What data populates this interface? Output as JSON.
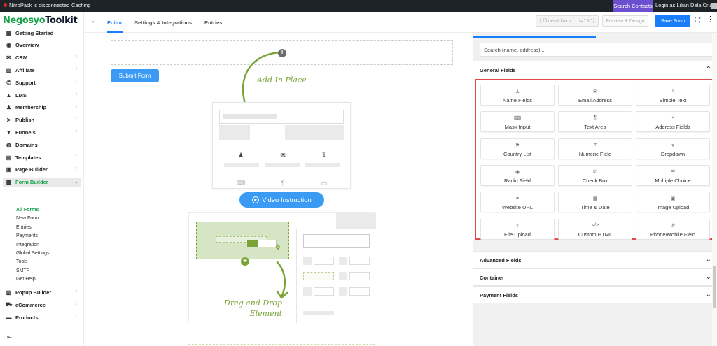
{
  "topbar": {
    "nitro": "NitroPack is disconnected",
    "caching": "Caching",
    "search_contacts": "Search Contacts",
    "login": "Login as Lilian Dela Cruz"
  },
  "logo": {
    "part1": "Negosyo",
    "part2": "Toolkit"
  },
  "sidebar": {
    "items": [
      {
        "label": "Getting Started",
        "icon": "grid-icon",
        "chevron": false
      },
      {
        "label": "Overview",
        "icon": "eye-icon",
        "chevron": false
      },
      {
        "label": "CRM",
        "icon": "mail-icon",
        "chevron": true
      },
      {
        "label": "Affiliate",
        "icon": "chart-icon",
        "chevron": true
      },
      {
        "label": "Support",
        "icon": "whatsapp-icon",
        "chevron": true
      },
      {
        "label": "LMS",
        "icon": "graduation-icon",
        "chevron": true
      },
      {
        "label": "Membership",
        "icon": "users-icon",
        "chevron": true
      },
      {
        "label": "Publish",
        "icon": "send-icon",
        "chevron": true
      },
      {
        "label": "Funnels",
        "icon": "funnel-icon",
        "chevron": true
      },
      {
        "label": "Domains",
        "icon": "globe-icon",
        "chevron": false
      },
      {
        "label": "Templates",
        "icon": "template-icon",
        "chevron": true
      },
      {
        "label": "Page Builder",
        "icon": "page-icon",
        "chevron": true
      },
      {
        "label": "Form Builder",
        "icon": "form-icon",
        "chevron": true
      }
    ],
    "sub_items": [
      "All Forms",
      "New Form",
      "Entries",
      "Payments",
      "Integration",
      "Global Settings",
      "Tools",
      "SMTP",
      "Get Help"
    ],
    "bottom_items": [
      {
        "label": "Popup Builder",
        "icon": "popup-icon",
        "chevron": true
      },
      {
        "label": "eCommerce",
        "icon": "cart-icon",
        "chevron": true
      },
      {
        "label": "Products",
        "icon": "box-icon",
        "chevron": true
      }
    ],
    "collapse_glyph": "⇤"
  },
  "nav": {
    "tabs": [
      "Editor",
      "Settings & Integrations",
      "Entries"
    ]
  },
  "header": {
    "shortcode": "[fluentform id=\"5\"]",
    "preview": "Preview & Design",
    "save": "Save Form"
  },
  "editor": {
    "submit": "Submit Form",
    "add_in_place": "Add In Place",
    "video": "Video Instruction",
    "drag_line1": "Drag and Drop",
    "drag_line2": "Element"
  },
  "panel": {
    "search_placeholder": "Search (name, address)...",
    "general_title": "General Fields",
    "fields": [
      {
        "label": "Name Fields",
        "icon": "user-icon",
        "glyph": "♙"
      },
      {
        "label": "Email Address",
        "icon": "envelope-icon",
        "glyph": "✉"
      },
      {
        "label": "Simple Text",
        "icon": "text-icon",
        "glyph": "T"
      },
      {
        "label": "Mask Input",
        "icon": "keyboard-icon",
        "glyph": "⌨"
      },
      {
        "label": "Text Area",
        "icon": "paragraph-icon",
        "glyph": "¶"
      },
      {
        "label": "Address Fields",
        "icon": "location-icon",
        "glyph": "⌖"
      },
      {
        "label": "Country List",
        "icon": "flag-icon",
        "glyph": "⚑"
      },
      {
        "label": "Numeric Field",
        "icon": "hash-icon",
        "glyph": "#"
      },
      {
        "label": "Dropdown",
        "icon": "dropdown-icon",
        "glyph": "▾"
      },
      {
        "label": "Radio Field",
        "icon": "radio-icon",
        "glyph": "◉"
      },
      {
        "label": "Check Box",
        "icon": "checkbox-icon",
        "glyph": "☑"
      },
      {
        "label": "Multiple Choice",
        "icon": "list-icon",
        "glyph": "☰"
      },
      {
        "label": "Website URL",
        "icon": "link-icon",
        "glyph": "⚭"
      },
      {
        "label": "Time & Date",
        "icon": "calendar-icon",
        "glyph": "▦"
      },
      {
        "label": "Image Upload",
        "icon": "image-icon",
        "glyph": "▣"
      },
      {
        "label": "File Upload",
        "icon": "upload-icon",
        "glyph": "⇧"
      },
      {
        "label": "Custom HTML",
        "icon": "code-icon",
        "glyph": "</>"
      },
      {
        "label": "Phone/Mobile Field",
        "icon": "phone-icon",
        "glyph": "✆"
      }
    ],
    "sections": [
      "Advanced Fields",
      "Container",
      "Payment Fields"
    ]
  }
}
